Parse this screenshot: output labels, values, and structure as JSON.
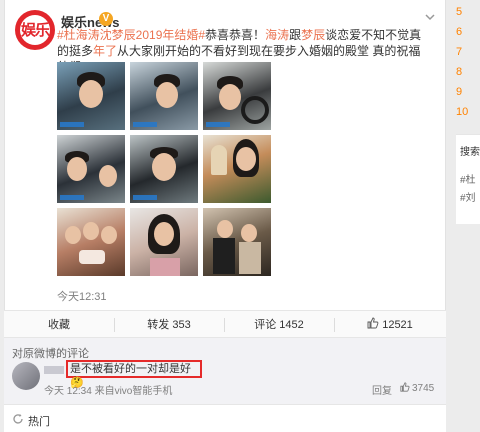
{
  "post": {
    "username": "娱乐news",
    "badge": "V",
    "avatar_text": "娱乐",
    "text_link1": "#杜海涛沈梦辰2019年结婚#",
    "text_plain1": "恭喜恭喜！",
    "text_link2": "海涛",
    "text_plain2": "跟",
    "text_link3": "梦辰",
    "text_plain3": "谈恋爱不知不觉真的挺多",
    "text_link4": "年了",
    "text_plain4": "从大家刚开始的不看好到现在要步入婚姻的殿堂 真的祝福他们",
    "hearts": "❤❤❤",
    "timestamp": "今天12:31"
  },
  "actions": {
    "collect": "收藏",
    "repost": "转发 353",
    "comment": "评论 1452",
    "like": "12521"
  },
  "comments": {
    "title": "对原微博的评论",
    "text": "是不被看好的一对却是好",
    "emoji": "🤔",
    "meta": "今天 12:34 来自vivo智能手机",
    "reply": "回复",
    "likes": "3745"
  },
  "hot": {
    "label": "热门"
  },
  "right_rank": [
    "5",
    "6",
    "7",
    "8",
    "9",
    "10"
  ],
  "side": {
    "title": "搜索",
    "tag1": "#杜",
    "tag2": "#刘"
  },
  "colors": {
    "link": "#eb7350",
    "rank": "#ff8200",
    "highlight_border": "#e52a2a"
  }
}
